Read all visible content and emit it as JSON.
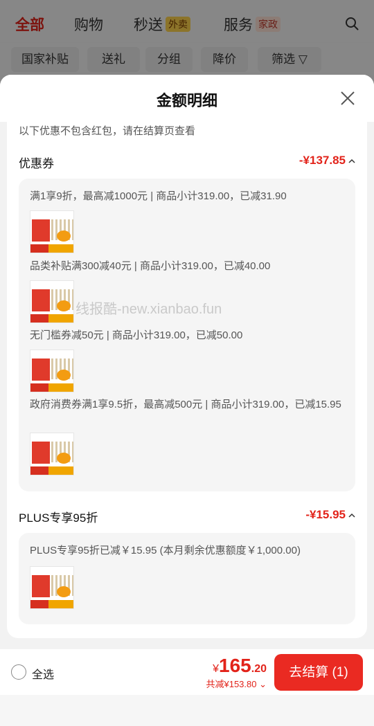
{
  "nav": {
    "tabs": [
      {
        "label": "全部"
      },
      {
        "label": "购物"
      },
      {
        "label": "秒送",
        "tag": "外卖"
      },
      {
        "label": "服务",
        "tag": "家政"
      }
    ],
    "filters": [
      "国家补贴",
      "送礼",
      "分组",
      "降价",
      "筛选"
    ]
  },
  "sheet": {
    "title": "金额明细",
    "notice": "以下优惠不包含红包，请在结算页查看"
  },
  "coupons": {
    "title": "优惠券",
    "amount": "-¥137.85",
    "items": [
      {
        "text": "满1享9折，最高减1000元 | 商品小计319.00，已减31.90"
      },
      {
        "text": "品类补贴满300减40元 | 商品小计319.00，已减40.00"
      },
      {
        "text": "无门槛券减50元 | 商品小计319.00，已减50.00"
      },
      {
        "text": "政府消费券满1享9.5折，最高减500元 | 商品小计319.00，已减15.95"
      }
    ]
  },
  "plus": {
    "title": "PLUS专享95折",
    "amount": "-¥15.95",
    "items": [
      {
        "text": "PLUS专享95折已减￥15.95 (本月剩余优惠额度￥1,000.00)"
      }
    ]
  },
  "watermark": "线报酷-new.xianbao.fun",
  "footer": {
    "select_all": "全选",
    "total_yen": "¥",
    "total_int": "165",
    "total_dec": ".20",
    "saved": "共减¥153.80",
    "checkout": "去结算 (1)"
  },
  "colors": {
    "accent": "#e2231a",
    "button": "#ea2a22"
  }
}
